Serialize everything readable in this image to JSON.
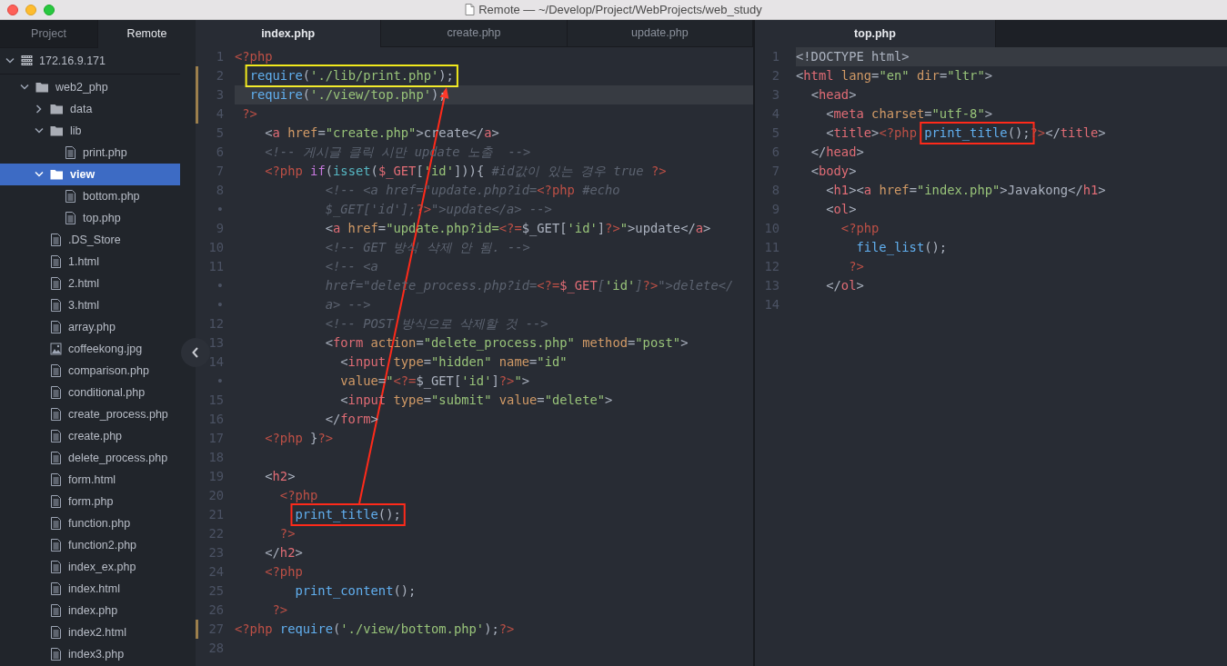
{
  "window": {
    "title": "Remote — ~/Develop/Project/WebProjects/web_study"
  },
  "sidebar": {
    "tabs": [
      {
        "label": "Project",
        "selected": false
      },
      {
        "label": "Remote",
        "selected": true
      }
    ],
    "tree": [
      {
        "label": "172.16.9.171",
        "kind": "server",
        "expanded": true,
        "selected": false,
        "children": [
          {
            "label": "web2_php",
            "kind": "folder",
            "expanded": true,
            "selected": false,
            "children": [
              {
                "label": "data",
                "kind": "folder",
                "expanded": false,
                "selected": false
              },
              {
                "label": "lib",
                "kind": "folder",
                "expanded": true,
                "selected": false,
                "children": [
                  {
                    "label": "print.php",
                    "kind": "file",
                    "selected": false
                  }
                ]
              },
              {
                "label": "view",
                "kind": "folder",
                "expanded": true,
                "selected": true,
                "children": [
                  {
                    "label": "bottom.php",
                    "kind": "file",
                    "selected": false
                  },
                  {
                    "label": "top.php",
                    "kind": "file",
                    "selected": false
                  }
                ]
              },
              {
                "label": ".DS_Store",
                "kind": "file",
                "selected": false
              },
              {
                "label": "1.html",
                "kind": "file",
                "selected": false
              },
              {
                "label": "2.html",
                "kind": "file",
                "selected": false
              },
              {
                "label": "3.html",
                "kind": "file",
                "selected": false
              },
              {
                "label": "array.php",
                "kind": "file",
                "selected": false
              },
              {
                "label": "coffeekong.jpg",
                "kind": "image",
                "selected": false
              },
              {
                "label": "comparison.php",
                "kind": "file",
                "selected": false
              },
              {
                "label": "conditional.php",
                "kind": "file",
                "selected": false
              },
              {
                "label": "create_process.php",
                "kind": "file",
                "selected": false
              },
              {
                "label": "create.php",
                "kind": "file",
                "selected": false
              },
              {
                "label": "delete_process.php",
                "kind": "file",
                "selected": false
              },
              {
                "label": "form.html",
                "kind": "file",
                "selected": false
              },
              {
                "label": "form.php",
                "kind": "file",
                "selected": false
              },
              {
                "label": "function.php",
                "kind": "file",
                "selected": false
              },
              {
                "label": "function2.php",
                "kind": "file",
                "selected": false
              },
              {
                "label": "index_ex.php",
                "kind": "file",
                "selected": false
              },
              {
                "label": "index.html",
                "kind": "file",
                "selected": false
              },
              {
                "label": "index.php",
                "kind": "file",
                "selected": false
              },
              {
                "label": "index2.html",
                "kind": "file",
                "selected": false
              },
              {
                "label": "index3.php",
                "kind": "file",
                "selected": false
              }
            ]
          }
        ]
      }
    ]
  },
  "panes": [
    {
      "tabs": [
        {
          "label": "index.php",
          "selected": true
        },
        {
          "label": "create.php",
          "selected": false
        },
        {
          "label": "update.php",
          "selected": false
        }
      ],
      "lines": [
        {
          "number": "1",
          "modified": false,
          "current": false,
          "tokens": [
            {
              "text": "<?php",
              "kind": "php"
            }
          ]
        },
        {
          "number": "2",
          "modified": true,
          "current": false,
          "tokens": [
            {
              "kind": "box",
              "color": "#f2ea1c",
              "tokens": [
                {
                  "text": "  require",
                  "kind": "fn"
                },
                {
                  "text": "(",
                  "kind": "p"
                },
                {
                  "text": "'./lib/print.php'",
                  "kind": "str"
                },
                {
                  "text": ");",
                  "kind": "p"
                }
              ]
            }
          ]
        },
        {
          "number": "3",
          "modified": true,
          "current": true,
          "tokens": [
            {
              "text": "  require",
              "kind": "fn"
            },
            {
              "text": "(",
              "kind": "p"
            },
            {
              "text": "'./view/top.php'",
              "kind": "str"
            },
            {
              "text": ");",
              "kind": "p"
            }
          ]
        },
        {
          "number": "4",
          "modified": true,
          "current": false,
          "tokens": [
            {
              "text": " ?>",
              "kind": "php"
            }
          ]
        },
        {
          "number": "5",
          "modified": false,
          "current": false,
          "tokens": [
            {
              "text": "    <",
              "kind": "p"
            },
            {
              "text": "a",
              "kind": "tag"
            },
            {
              "text": " href",
              "kind": "attr"
            },
            {
              "text": "=",
              "kind": "p"
            },
            {
              "text": "\"create.php\"",
              "kind": "str"
            },
            {
              "text": ">create</",
              "kind": "p"
            },
            {
              "text": "a",
              "kind": "tag"
            },
            {
              "text": ">",
              "kind": "p"
            }
          ]
        },
        {
          "number": "6",
          "modified": false,
          "current": false,
          "tokens": [
            {
              "text": "    <!-- 게시글 클릭 시만 update 노출  -->",
              "kind": "cmt"
            }
          ]
        },
        {
          "number": "7",
          "modified": false,
          "current": false,
          "tokens": [
            {
              "text": "    <?php ",
              "kind": "php"
            },
            {
              "text": "if",
              "kind": "kw"
            },
            {
              "text": "(",
              "kind": "p"
            },
            {
              "text": "isset",
              "kind": "bi"
            },
            {
              "text": "(",
              "kind": "p"
            },
            {
              "text": "$_GET",
              "kind": "var"
            },
            {
              "text": "[",
              "kind": "p"
            },
            {
              "text": "'id'",
              "kind": "str"
            },
            {
              "text": "])){ ",
              "kind": "p"
            },
            {
              "text": "#id값이 있는 경우 true ",
              "kind": "cmt"
            },
            {
              "text": "?>",
              "kind": "php"
            }
          ]
        },
        {
          "number": "8",
          "modified": false,
          "current": false,
          "tokens": [
            {
              "text": "            <!-- <a href=\"update.php?id=",
              "kind": "cmt"
            },
            {
              "text": "<?php",
              "kind": "php"
            },
            {
              "text": " #echo",
              "kind": "cmt"
            }
          ]
        },
        {
          "number": "•",
          "modified": false,
          "current": false,
          "tokens": [
            {
              "text": "            $_GET['id'];",
              "kind": "cmt"
            },
            {
              "text": "?>",
              "kind": "php"
            },
            {
              "text": "\">update</a> -->",
              "kind": "cmt"
            }
          ]
        },
        {
          "number": "9",
          "modified": false,
          "current": false,
          "tokens": [
            {
              "text": "            <",
              "kind": "p"
            },
            {
              "text": "a",
              "kind": "tag"
            },
            {
              "text": " href",
              "kind": "attr"
            },
            {
              "text": "=",
              "kind": "p"
            },
            {
              "text": "\"update.php?id=",
              "kind": "str"
            },
            {
              "text": "<?=",
              "kind": "php"
            },
            {
              "text": "$_GET[",
              "kind": "p"
            },
            {
              "text": "'id'",
              "kind": "str"
            },
            {
              "text": "]",
              "kind": "p"
            },
            {
              "text": "?>",
              "kind": "php"
            },
            {
              "text": "\"",
              "kind": "str"
            },
            {
              "text": ">update</",
              "kind": "p"
            },
            {
              "text": "a",
              "kind": "tag"
            },
            {
              "text": ">",
              "kind": "p"
            }
          ]
        },
        {
          "number": "10",
          "modified": false,
          "current": false,
          "tokens": [
            {
              "text": "            <!-- GET 방식 삭제 안 됨. -->",
              "kind": "cmt"
            }
          ]
        },
        {
          "number": "11",
          "modified": false,
          "current": false,
          "tokens": [
            {
              "text": "            <!-- <a",
              "kind": "cmt"
            }
          ]
        },
        {
          "number": "•",
          "modified": false,
          "current": false,
          "tokens": [
            {
              "text": "            href=\"delete_process.php?id=",
              "kind": "cmt"
            },
            {
              "text": "<?=",
              "kind": "php"
            },
            {
              "text": "$_GET",
              "kind": "var"
            },
            {
              "text": "[",
              "kind": "cmt"
            },
            {
              "text": "'id'",
              "kind": "str"
            },
            {
              "text": "]",
              "kind": "cmt"
            },
            {
              "text": "?>",
              "kind": "php"
            },
            {
              "text": "\">delete</",
              "kind": "cmt"
            }
          ]
        },
        {
          "number": "•",
          "modified": false,
          "current": false,
          "tokens": [
            {
              "text": "            a> -->",
              "kind": "cmt"
            }
          ]
        },
        {
          "number": "12",
          "modified": false,
          "current": false,
          "tokens": [
            {
              "text": "            <!-- POST 방식으로 삭제할 것 -->",
              "kind": "cmt"
            }
          ]
        },
        {
          "number": "13",
          "modified": false,
          "current": false,
          "tokens": [
            {
              "text": "            <",
              "kind": "p"
            },
            {
              "text": "form",
              "kind": "tag"
            },
            {
              "text": " action",
              "kind": "attr"
            },
            {
              "text": "=",
              "kind": "p"
            },
            {
              "text": "\"delete_process.php\"",
              "kind": "str"
            },
            {
              "text": " method",
              "kind": "attr"
            },
            {
              "text": "=",
              "kind": "p"
            },
            {
              "text": "\"post\"",
              "kind": "str"
            },
            {
              "text": ">",
              "kind": "p"
            }
          ]
        },
        {
          "number": "14",
          "modified": false,
          "current": false,
          "tokens": [
            {
              "text": "              <",
              "kind": "p"
            },
            {
              "text": "input",
              "kind": "tag"
            },
            {
              "text": " type",
              "kind": "attr"
            },
            {
              "text": "=",
              "kind": "p"
            },
            {
              "text": "\"hidden\"",
              "kind": "str"
            },
            {
              "text": " name",
              "kind": "attr"
            },
            {
              "text": "=",
              "kind": "p"
            },
            {
              "text": "\"id\"",
              "kind": "str"
            }
          ]
        },
        {
          "number": "•",
          "modified": false,
          "current": false,
          "tokens": [
            {
              "text": "              value",
              "kind": "attr"
            },
            {
              "text": "=",
              "kind": "p"
            },
            {
              "text": "\"",
              "kind": "str"
            },
            {
              "text": "<?=",
              "kind": "php"
            },
            {
              "text": "$_GET[",
              "kind": "p"
            },
            {
              "text": "'id'",
              "kind": "str"
            },
            {
              "text": "]",
              "kind": "p"
            },
            {
              "text": "?>",
              "kind": "php"
            },
            {
              "text": "\"",
              "kind": "str"
            },
            {
              "text": ">",
              "kind": "p"
            }
          ]
        },
        {
          "number": "15",
          "modified": false,
          "current": false,
          "tokens": [
            {
              "text": "              <",
              "kind": "p"
            },
            {
              "text": "input",
              "kind": "tag"
            },
            {
              "text": " type",
              "kind": "attr"
            },
            {
              "text": "=",
              "kind": "p"
            },
            {
              "text": "\"submit\"",
              "kind": "str"
            },
            {
              "text": " value",
              "kind": "attr"
            },
            {
              "text": "=",
              "kind": "p"
            },
            {
              "text": "\"delete\"",
              "kind": "str"
            },
            {
              "text": ">",
              "kind": "p"
            }
          ]
        },
        {
          "number": "16",
          "modified": false,
          "current": false,
          "tokens": [
            {
              "text": "            </",
              "kind": "p"
            },
            {
              "text": "form",
              "kind": "tag"
            },
            {
              "text": ">",
              "kind": "p"
            }
          ]
        },
        {
          "number": "17",
          "modified": false,
          "current": false,
          "tokens": [
            {
              "text": "    <?php ",
              "kind": "php"
            },
            {
              "text": "}",
              "kind": "p"
            },
            {
              "text": "?>",
              "kind": "php"
            }
          ]
        },
        {
          "number": "18",
          "modified": false,
          "current": false
        },
        {
          "number": "19",
          "modified": false,
          "current": false,
          "tokens": [
            {
              "text": "    <",
              "kind": "p"
            },
            {
              "text": "h2",
              "kind": "tag"
            },
            {
              "text": ">",
              "kind": "p"
            }
          ]
        },
        {
          "number": "20",
          "modified": false,
          "current": false,
          "tokens": [
            {
              "text": "      <?php",
              "kind": "php"
            }
          ]
        },
        {
          "number": "21",
          "modified": false,
          "current": false,
          "tokens": [
            {
              "kind": "box",
              "color": "#ff2a1a",
              "tokens": [
                {
                  "text": "        print_title",
                  "kind": "fn"
                },
                {
                  "text": "();",
                  "kind": "p"
                }
              ]
            }
          ]
        },
        {
          "number": "22",
          "modified": false,
          "current": false,
          "tokens": [
            {
              "text": "      ?>",
              "kind": "php"
            }
          ]
        },
        {
          "number": "23",
          "modified": false,
          "current": false,
          "tokens": [
            {
              "text": "    </",
              "kind": "p"
            },
            {
              "text": "h2",
              "kind": "tag"
            },
            {
              "text": ">",
              "kind": "p"
            }
          ]
        },
        {
          "number": "24",
          "modified": false,
          "current": false,
          "tokens": [
            {
              "text": "    <?php",
              "kind": "php"
            }
          ]
        },
        {
          "number": "25",
          "modified": false,
          "current": false,
          "tokens": [
            {
              "text": "        print_content",
              "kind": "fn"
            },
            {
              "text": "();",
              "kind": "p"
            }
          ]
        },
        {
          "number": "26",
          "modified": false,
          "current": false,
          "tokens": [
            {
              "text": "     ?>",
              "kind": "php"
            }
          ]
        },
        {
          "number": "27",
          "modified": true,
          "current": false,
          "tokens": [
            {
              "text": "<?php ",
              "kind": "php"
            },
            {
              "text": "require",
              "kind": "fn"
            },
            {
              "text": "(",
              "kind": "p"
            },
            {
              "text": "'./view/bottom.php'",
              "kind": "str"
            },
            {
              "text": ");",
              "kind": "p"
            },
            {
              "text": "?>",
              "kind": "php"
            }
          ]
        },
        {
          "number": "28",
          "modified": false,
          "current": false
        }
      ]
    },
    {
      "tabs": [
        {
          "label": "top.php",
          "selected": true
        }
      ],
      "lines": [
        {
          "number": "1",
          "modified": false,
          "current": true,
          "tokens": [
            {
              "text": "<!DOCTYPE html>",
              "kind": "p"
            }
          ]
        },
        {
          "number": "2",
          "modified": false,
          "current": false,
          "tokens": [
            {
              "text": "<",
              "kind": "p"
            },
            {
              "text": "html",
              "kind": "tag"
            },
            {
              "text": " lang",
              "kind": "attr"
            },
            {
              "text": "=",
              "kind": "p"
            },
            {
              "text": "\"en\"",
              "kind": "str"
            },
            {
              "text": " dir",
              "kind": "attr"
            },
            {
              "text": "=",
              "kind": "p"
            },
            {
              "text": "\"ltr\"",
              "kind": "str"
            },
            {
              "text": ">",
              "kind": "p"
            }
          ]
        },
        {
          "number": "3",
          "modified": false,
          "current": false,
          "tokens": [
            {
              "text": "  <",
              "kind": "p"
            },
            {
              "text": "head",
              "kind": "tag"
            },
            {
              "text": ">",
              "kind": "p"
            }
          ]
        },
        {
          "number": "4",
          "modified": false,
          "current": false,
          "tokens": [
            {
              "text": "    <",
              "kind": "p"
            },
            {
              "text": "meta",
              "kind": "tag"
            },
            {
              "text": " charset",
              "kind": "attr"
            },
            {
              "text": "=",
              "kind": "p"
            },
            {
              "text": "\"utf-8\"",
              "kind": "str"
            },
            {
              "text": ">",
              "kind": "p"
            }
          ]
        },
        {
          "number": "5",
          "modified": false,
          "current": false,
          "tokens": [
            {
              "text": "    <",
              "kind": "p"
            },
            {
              "text": "title",
              "kind": "tag"
            },
            {
              "text": ">",
              "kind": "p"
            },
            {
              "text": "<?php ",
              "kind": "php"
            },
            {
              "kind": "box",
              "color": "#ff2a1a",
              "tokens": [
                {
                  "text": "print_title",
                  "kind": "fn"
                },
                {
                  "text": "();",
                  "kind": "p"
                }
              ]
            },
            {
              "text": "?>",
              "kind": "php"
            },
            {
              "text": "</",
              "kind": "p"
            },
            {
              "text": "title",
              "kind": "tag"
            },
            {
              "text": ">",
              "kind": "p"
            }
          ]
        },
        {
          "number": "6",
          "modified": false,
          "current": false,
          "tokens": [
            {
              "text": "  </",
              "kind": "p"
            },
            {
              "text": "head",
              "kind": "tag"
            },
            {
              "text": ">",
              "kind": "p"
            }
          ]
        },
        {
          "number": "7",
          "modified": false,
          "current": false,
          "tokens": [
            {
              "text": "  <",
              "kind": "p"
            },
            {
              "text": "body",
              "kind": "tag"
            },
            {
              "text": ">",
              "kind": "p"
            }
          ]
        },
        {
          "number": "8",
          "modified": false,
          "current": false,
          "tokens": [
            {
              "text": "    <",
              "kind": "p"
            },
            {
              "text": "h1",
              "kind": "tag"
            },
            {
              "text": "><",
              "kind": "p"
            },
            {
              "text": "a",
              "kind": "tag"
            },
            {
              "text": " href",
              "kind": "attr"
            },
            {
              "text": "=",
              "kind": "p"
            },
            {
              "text": "\"index.php\"",
              "kind": "str"
            },
            {
              "text": ">Javakong</",
              "kind": "p"
            },
            {
              "text": "h1",
              "kind": "tag"
            },
            {
              "text": ">",
              "kind": "p"
            }
          ]
        },
        {
          "number": "9",
          "modified": false,
          "current": false,
          "tokens": [
            {
              "text": "    <",
              "kind": "p"
            },
            {
              "text": "ol",
              "kind": "tag"
            },
            {
              "text": ">",
              "kind": "p"
            }
          ]
        },
        {
          "number": "10",
          "modified": false,
          "current": false,
          "tokens": [
            {
              "text": "      <?php",
              "kind": "php"
            }
          ]
        },
        {
          "number": "11",
          "modified": false,
          "current": false,
          "tokens": [
            {
              "text": "        file_list",
              "kind": "fn"
            },
            {
              "text": "();",
              "kind": "p"
            }
          ]
        },
        {
          "number": "12",
          "modified": false,
          "current": false,
          "tokens": [
            {
              "text": "       ?>",
              "kind": "php"
            }
          ]
        },
        {
          "number": "13",
          "modified": false,
          "current": false,
          "tokens": [
            {
              "text": "    </",
              "kind": "p"
            },
            {
              "text": "ol",
              "kind": "tag"
            },
            {
              "text": ">",
              "kind": "p"
            }
          ]
        },
        {
          "number": "14",
          "modified": false,
          "current": false
        }
      ]
    }
  ]
}
